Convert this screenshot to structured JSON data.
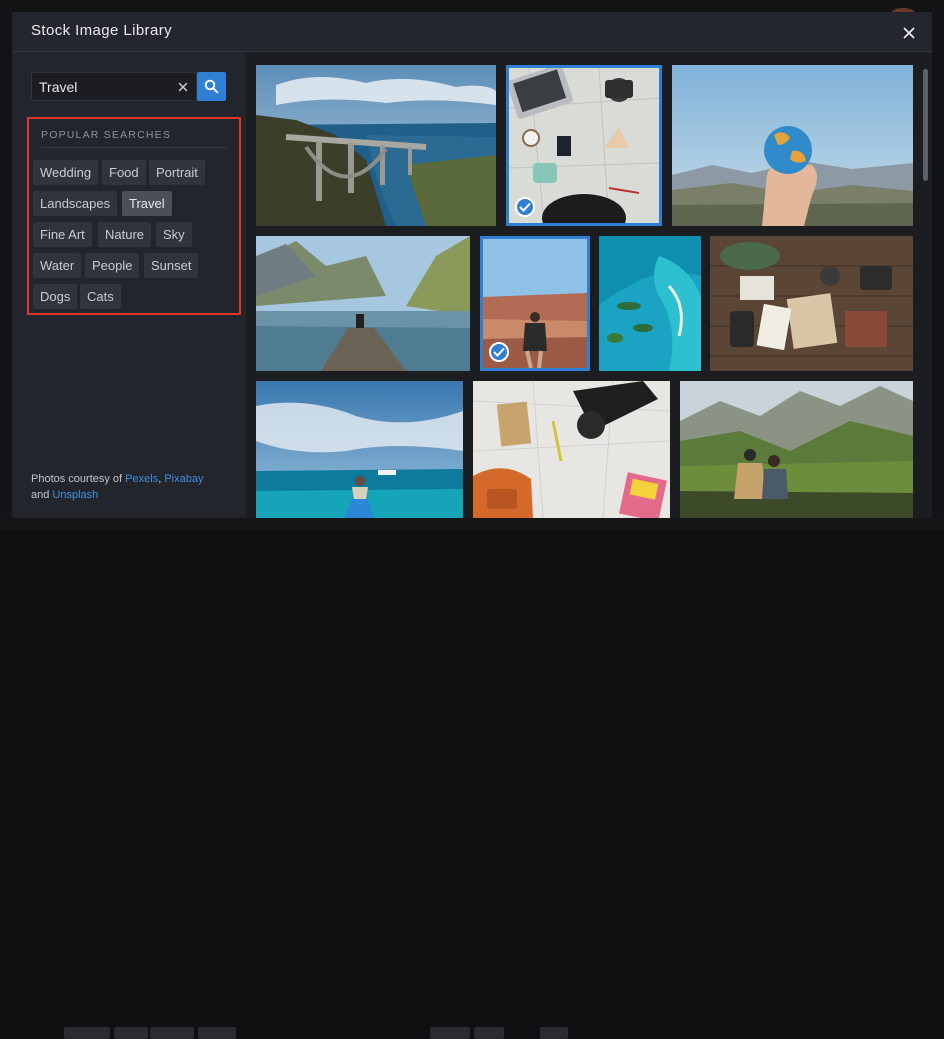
{
  "modal": {
    "title": "Stock Image Library"
  },
  "search": {
    "value": "Travel",
    "placeholder": "Search"
  },
  "popular": {
    "title": "POPULAR SEARCHES",
    "tags": [
      "Wedding",
      "Food",
      "Portrait",
      "Landscapes",
      "Travel",
      "Fine Art",
      "Nature",
      "Sky",
      "Water",
      "People",
      "Sunset",
      "Dogs",
      "Cats"
    ],
    "active_tag": "Travel"
  },
  "credits": {
    "prefix": "Photos courtesy of ",
    "sep1": ", ",
    "sep2": " and ",
    "sources": [
      "Pexels",
      "Pixabay",
      "Unsplash"
    ]
  },
  "images": [
    {
      "subject": "coastal-bridge",
      "selected": false
    },
    {
      "subject": "desk-map-camera",
      "selected": true
    },
    {
      "subject": "hand-holding-globe",
      "selected": false
    },
    {
      "subject": "lake-pier-mountains",
      "selected": false
    },
    {
      "subject": "traveler-backpack-city",
      "selected": true
    },
    {
      "subject": "aerial-lagoon",
      "selected": false
    },
    {
      "subject": "flatlay-travel-gear",
      "selected": false
    },
    {
      "subject": "paddleboard-sea",
      "selected": false
    },
    {
      "subject": "map-camera-backpack",
      "selected": false
    },
    {
      "subject": "couple-mountain-view",
      "selected": false
    }
  ],
  "colors": {
    "accent": "#2f7fd4",
    "highlight_border": "#e0372b",
    "link": "#3f8fe0"
  }
}
